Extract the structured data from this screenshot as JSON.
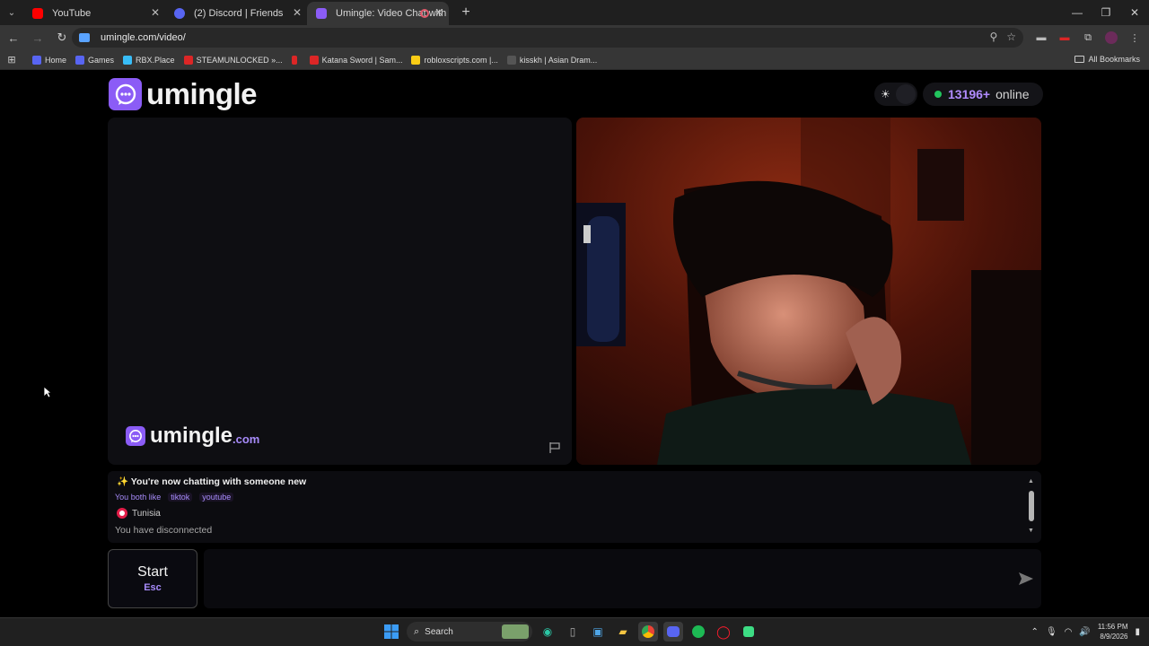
{
  "tabs": [
    {
      "title": "YouTube",
      "favicon_color": "#ff0000",
      "active": false
    },
    {
      "title": "(2) Discord | Friends",
      "favicon_color": "#5865f2",
      "active": false
    },
    {
      "title": "Umingle: Video Chat with S",
      "favicon_color": "#8b5cf6",
      "active": true
    }
  ],
  "address": {
    "url": "umingle.com/video/"
  },
  "bookmarks": [
    {
      "label": "Home",
      "color": "#5865f2"
    },
    {
      "label": "Games",
      "color": "#5865f2"
    },
    {
      "label": "RBX.Place",
      "color": "#38bdf8"
    },
    {
      "label": "STEAMUNLOCKED »...",
      "color": "#dc2626"
    },
    {
      "label": "",
      "color": "#dc2626"
    },
    {
      "label": "Katana Sword | Sam...",
      "color": "#dc2626"
    },
    {
      "label": "robloxscripts.com |...",
      "color": "#facc15"
    },
    {
      "label": "kisskh | Asian Dram...",
      "color": "#555555"
    }
  ],
  "bookmarks_all": "All Bookmarks",
  "site": {
    "logo_text": "umingle",
    "watermark_text": "umingle",
    "watermark_suffix": ".com",
    "online_count": "13196+",
    "online_label": "online",
    "accent_color": "#8b5cf6"
  },
  "chat": {
    "intro": "✨ You're now chatting with someone new",
    "both_like_label": "You both like",
    "interests": [
      "tiktok",
      "youtube"
    ],
    "country": "Tunisia",
    "status": "You have disconnected"
  },
  "controls": {
    "start_label": "Start",
    "start_hint": "Esc",
    "message_placeholder": ""
  },
  "taskbar": {
    "search_label": "Search",
    "time": "11:56 PM",
    "date": "8/9/2026"
  }
}
